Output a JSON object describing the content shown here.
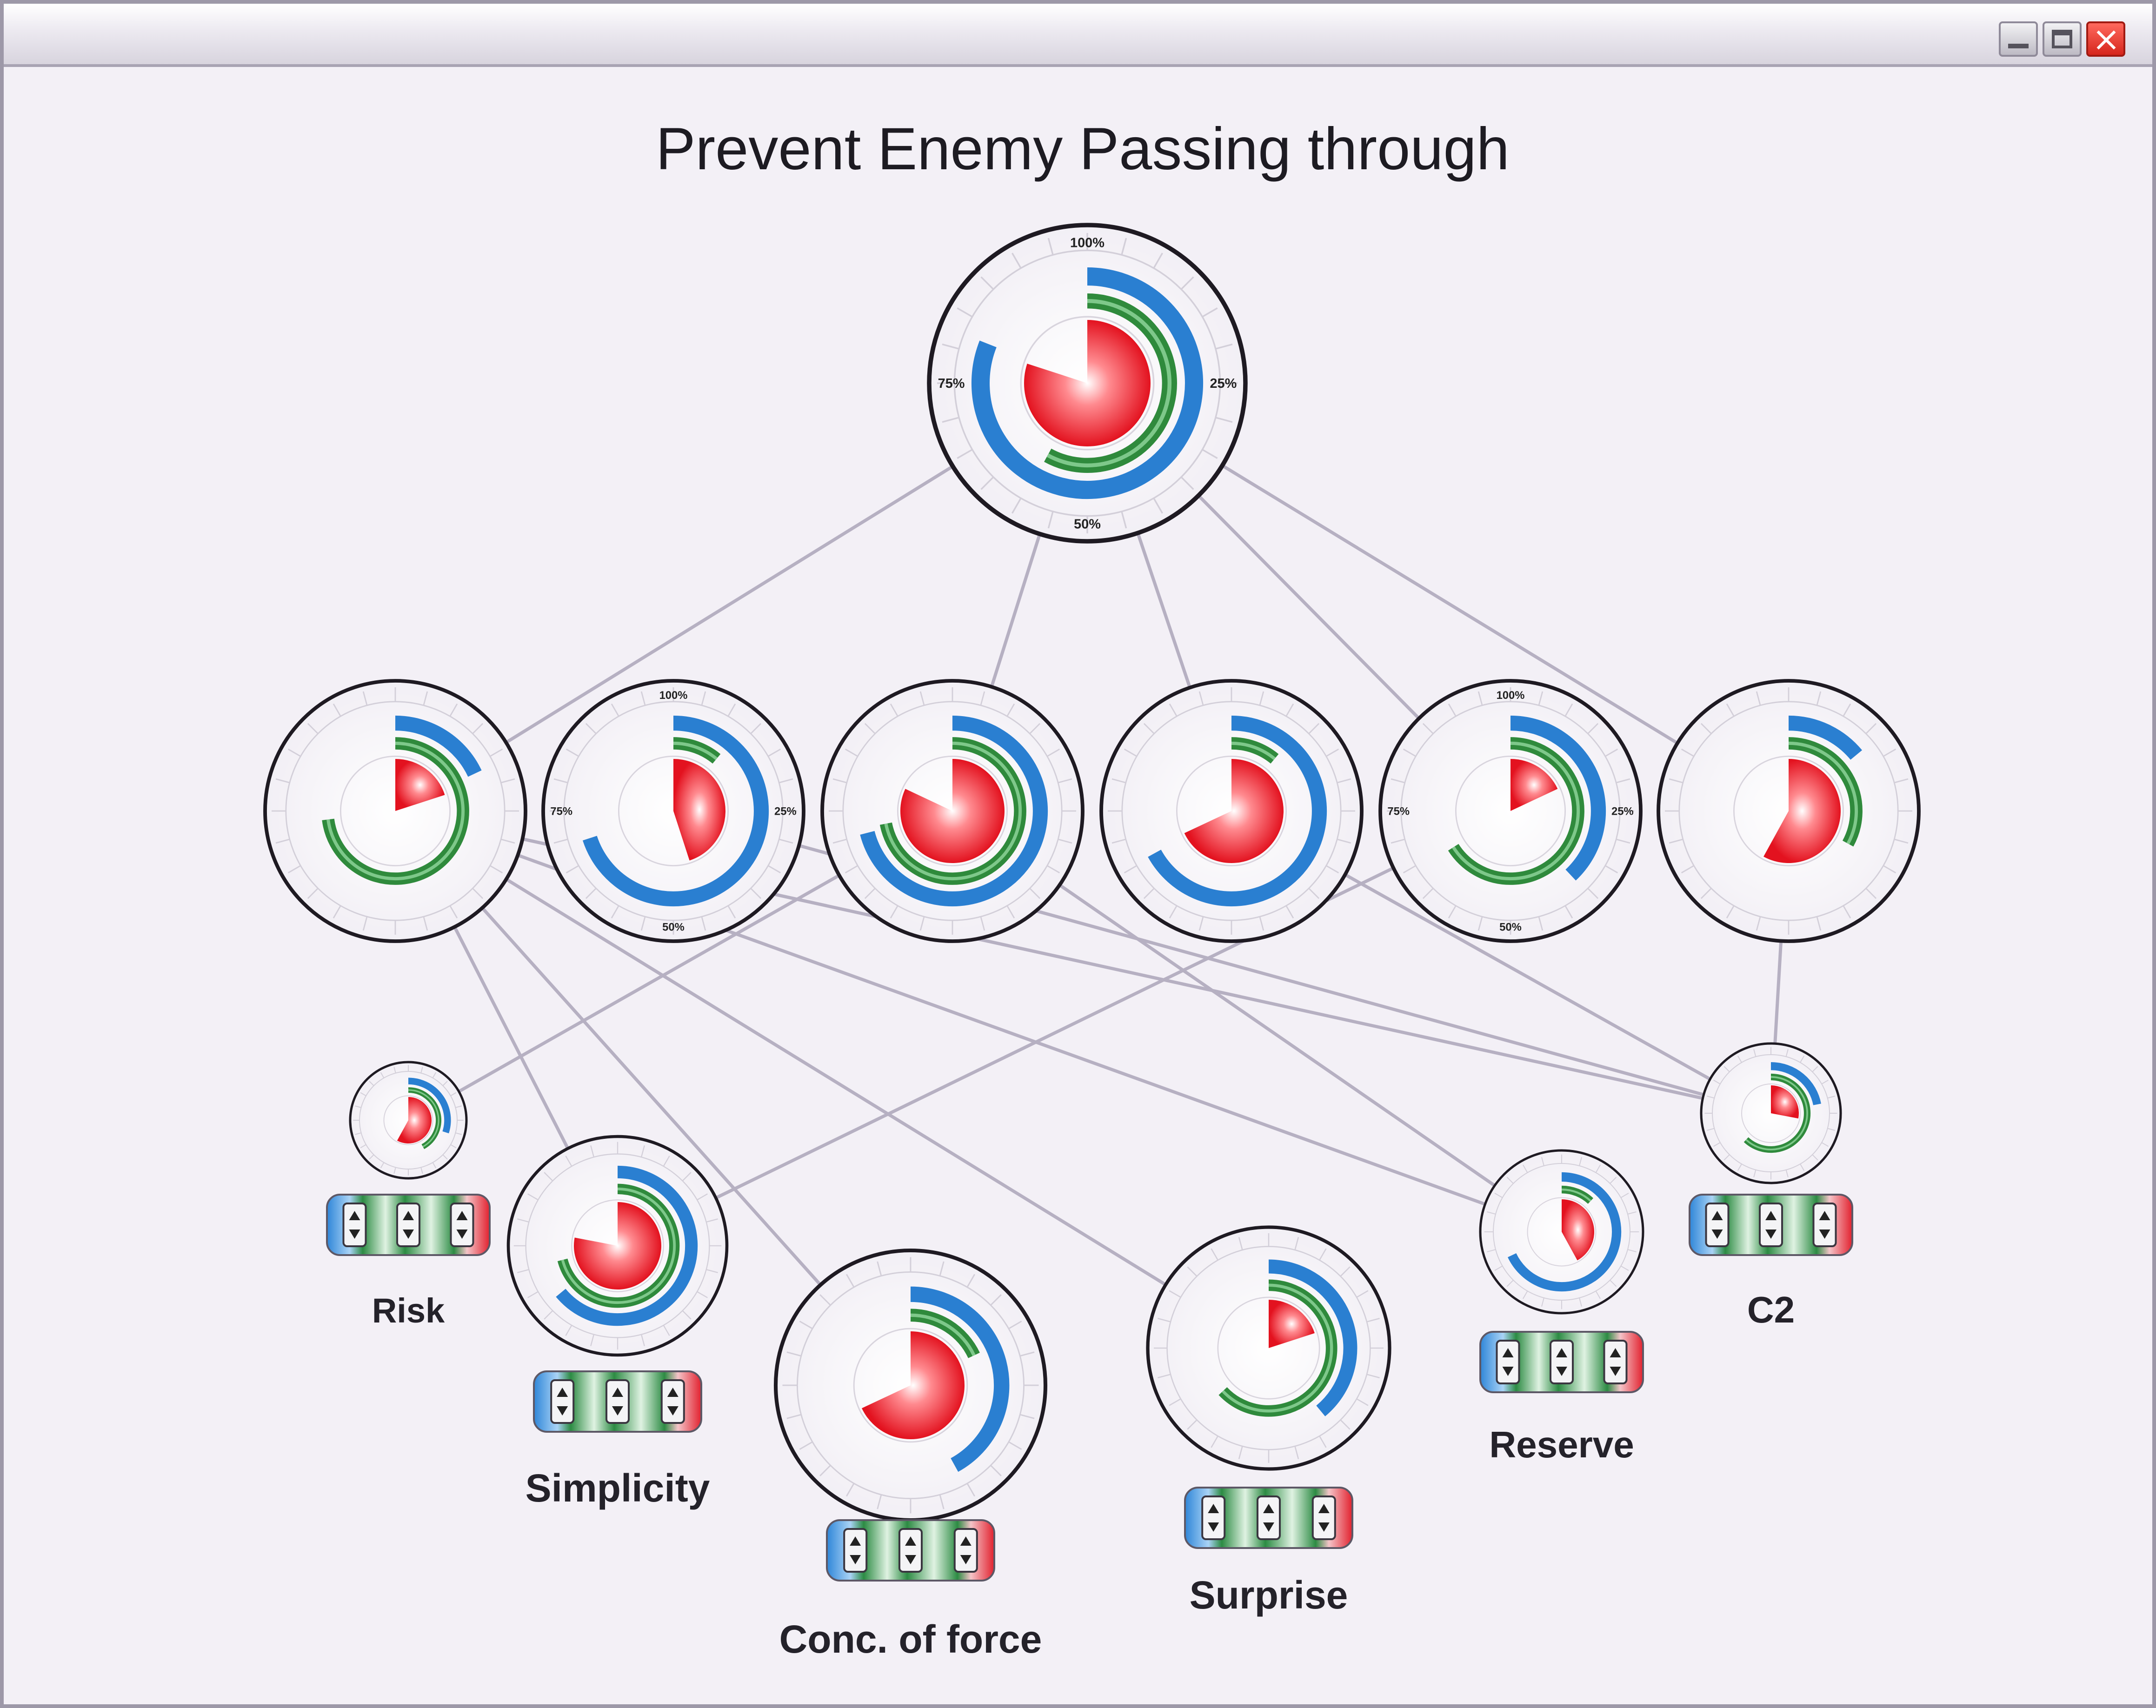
{
  "window": {
    "controls": [
      "minimize",
      "maximize",
      "close"
    ]
  },
  "title": "Prevent Enemy Passing through",
  "colors": {
    "blue": "#2a7fd1",
    "green": "#2f8a3c",
    "red": "#e8242f",
    "link": "#b6b0c2",
    "ring": "#1e1a22"
  },
  "percent_labels": [
    "100%",
    "25%",
    "50%",
    "75%"
  ],
  "nodes": [
    {
      "id": "root",
      "label": "",
      "has_percent_labels": true,
      "blue": 0.81,
      "green": 0.58,
      "red": 0.8
    },
    {
      "id": "m1",
      "label": "",
      "has_percent_labels": false,
      "blue": 0.18,
      "green": 0.73,
      "red": 0.2
    },
    {
      "id": "m2",
      "label": "",
      "has_percent_labels": true,
      "blue": 0.7,
      "green": 0.11,
      "red": 0.45
    },
    {
      "id": "m3",
      "label": "",
      "has_percent_labels": false,
      "blue": 0.71,
      "green": 0.72,
      "red": 0.82
    },
    {
      "id": "m4",
      "label": "",
      "has_percent_labels": false,
      "blue": 0.67,
      "green": 0.11,
      "red": 0.68
    },
    {
      "id": "m5",
      "label": "",
      "has_percent_labels": true,
      "blue": 0.38,
      "green": 0.66,
      "red": 0.18
    },
    {
      "id": "m6",
      "label": "",
      "has_percent_labels": false,
      "blue": 0.14,
      "green": 0.33,
      "red": 0.58
    },
    {
      "id": "risk",
      "label": "Risk",
      "has_percent_labels": false,
      "blue": 0.3,
      "green": 0.42,
      "red": 0.58
    },
    {
      "id": "simplicity",
      "label": "Simplicity",
      "has_percent_labels": false,
      "blue": 0.64,
      "green": 0.71,
      "red": 0.78
    },
    {
      "id": "conc",
      "label": "Conc. of force",
      "has_percent_labels": false,
      "blue": 0.42,
      "green": 0.18,
      "red": 0.68
    },
    {
      "id": "surprise",
      "label": "Surprise",
      "has_percent_labels": false,
      "blue": 0.39,
      "green": 0.63,
      "red": 0.2
    },
    {
      "id": "reserve",
      "label": "Reserve",
      "has_percent_labels": false,
      "blue": 0.68,
      "green": 0.12,
      "red": 0.42
    },
    {
      "id": "c2",
      "label": "C2",
      "has_percent_labels": false,
      "blue": 0.22,
      "green": 0.62,
      "red": 0.28
    }
  ],
  "edges": [
    [
      "root",
      "m1"
    ],
    [
      "root",
      "m3"
    ],
    [
      "root",
      "m4"
    ],
    [
      "root",
      "m5"
    ],
    [
      "root",
      "m6"
    ],
    [
      "m1",
      "simplicity"
    ],
    [
      "m1",
      "conc"
    ],
    [
      "m1",
      "surprise"
    ],
    [
      "m1",
      "reserve"
    ],
    [
      "m1",
      "c2"
    ],
    [
      "m2",
      "c2"
    ],
    [
      "m3",
      "risk"
    ],
    [
      "m3",
      "reserve"
    ],
    [
      "m4",
      "c2"
    ],
    [
      "m5",
      "simplicity"
    ],
    [
      "m6",
      "c2"
    ]
  ]
}
